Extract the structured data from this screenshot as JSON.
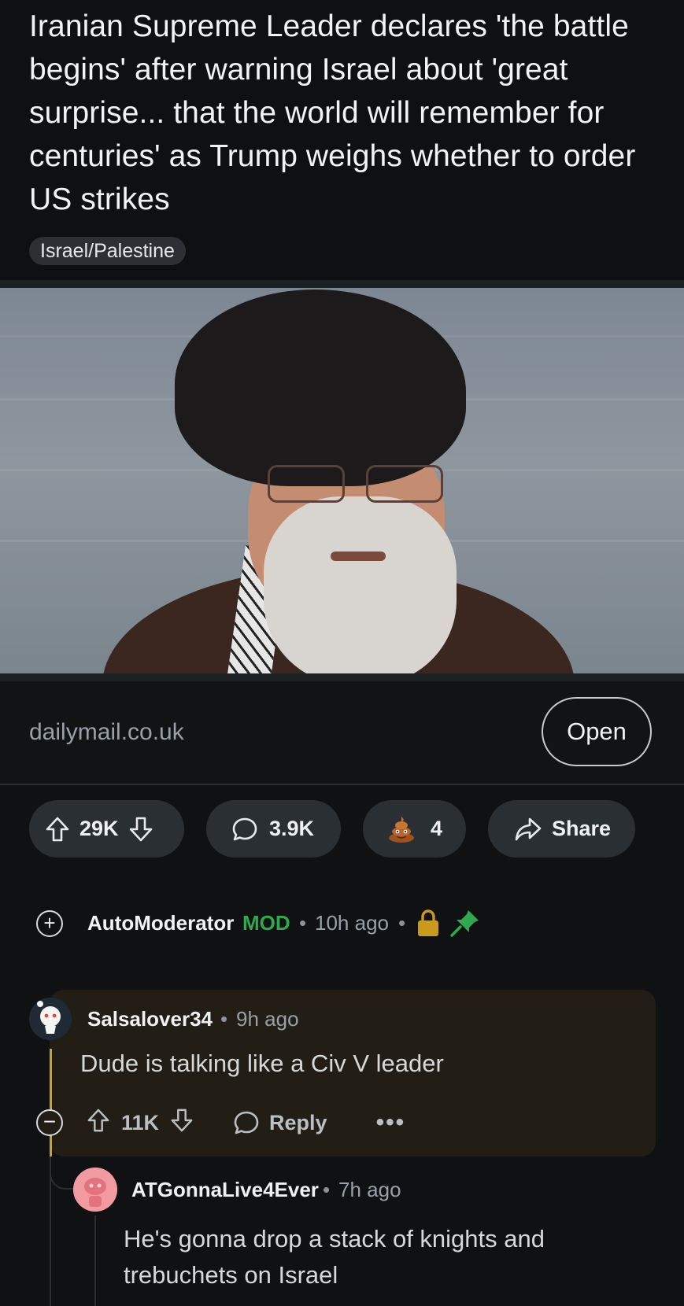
{
  "post": {
    "title": "Iranian Supreme Leader declares 'the battle begins' after warning Israel about 'great surprise... that the world will remember for centuries' as Trump weighs whether to order US strikes",
    "flair": "Israel/Palestine",
    "domain": "dailymail.co.uk",
    "open_label": "Open",
    "upvotes": "29K",
    "comments": "3.9K",
    "awards": "4",
    "share_label": "Share"
  },
  "automod": {
    "name": "AutoModerator",
    "badge": "MOD",
    "separator": "•",
    "time": "10h ago"
  },
  "comments": [
    {
      "user": "Salsalover34",
      "separator": "•",
      "time": "9h ago",
      "text": "Dude is talking like a Civ V leader",
      "votes": "11K",
      "reply_label": "Reply",
      "more": "•••"
    },
    {
      "user": "ATGonnaLive4Ever",
      "separator": "•",
      "time": "7h ago",
      "text": "He's gonna drop a stack of knights and trebuchets on Israel"
    }
  ],
  "colors": {
    "mod_green": "#2fa84f",
    "thread_highlight": "#c9a227",
    "lock": "#c99a1e"
  }
}
